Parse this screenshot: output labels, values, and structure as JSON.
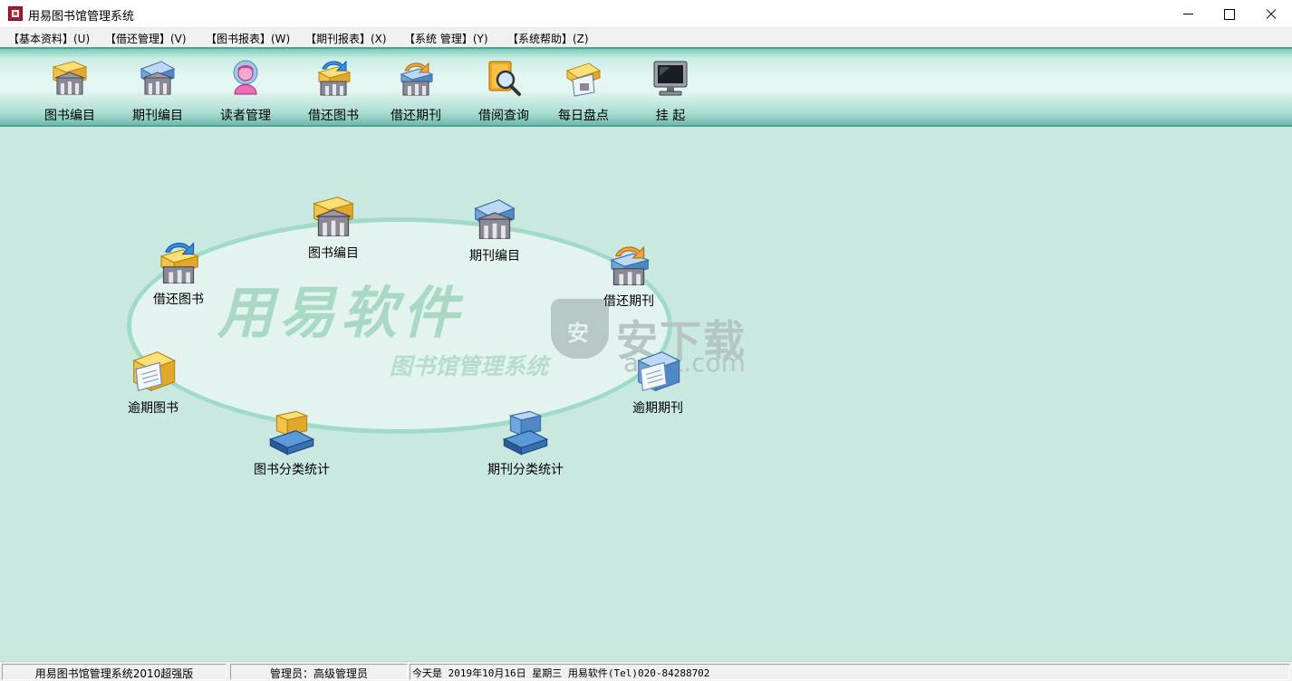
{
  "window": {
    "title": "用易图书馆管理系统"
  },
  "menu": [
    "【基本资料】(U)",
    "【借还管理】(V)",
    "【图书报表】(W)",
    "【期刊报表】(X)",
    "【系统 管理】(Y)",
    "【系统帮助】(Z)"
  ],
  "toolbar": [
    {
      "label": "图书编目",
      "icon": "book-catalog-icon"
    },
    {
      "label": "期刊编目",
      "icon": "periodical-catalog-icon"
    },
    {
      "label": "读者管理",
      "icon": "reader-icon"
    },
    {
      "label": "借还图书",
      "icon": "book-lend-icon"
    },
    {
      "label": "借还期刊",
      "icon": "periodical-lend-icon"
    },
    {
      "label": "借阅查询",
      "icon": "query-magnifier-icon"
    },
    {
      "label": "每日盘点",
      "icon": "daily-inventory-icon"
    },
    {
      "label": "挂  起",
      "icon": "monitor-icon"
    }
  ],
  "desktop": {
    "brand": "用易软件",
    "subtitle": "图书馆管理系统",
    "watermark": "安下载",
    "watermark_domain": "anxz.com",
    "items": {
      "book_catalog": {
        "label": "图书编目",
        "icon": "book-catalog-icon"
      },
      "periodical_catalog": {
        "label": "期刊编目",
        "icon": "periodical-catalog-icon"
      },
      "book_lend": {
        "label": "借还图书",
        "icon": "book-lend-icon"
      },
      "periodical_lend": {
        "label": "借还期刊",
        "icon": "periodical-lend-icon"
      },
      "overdue_book": {
        "label": "逾期图书",
        "icon": "overdue-book-icon"
      },
      "overdue_periodical": {
        "label": "逾期期刊",
        "icon": "overdue-periodical-icon"
      },
      "book_stats": {
        "label": "图书分类统计",
        "icon": "book-stats-icon"
      },
      "periodical_stats": {
        "label": "期刊分类统计",
        "icon": "periodical-stats-icon"
      }
    }
  },
  "status": {
    "app": "用易图书馆管理系统2010超强版",
    "admin": "管理员：高级管理员",
    "date": "今天是 2019年10月16日  星期三 用易软件(Tel)020-84288702"
  },
  "colors": {
    "book": "#f2c24a",
    "periodical": "#6fa6dc",
    "building": "#7a7a86",
    "background": "#c8e8e0",
    "toolbar_border": "#4aa594"
  }
}
